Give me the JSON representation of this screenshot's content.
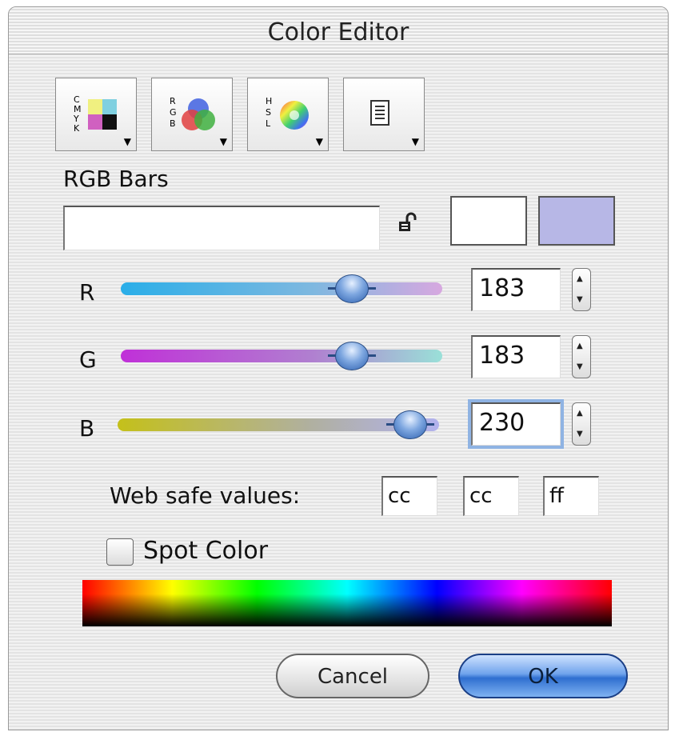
{
  "window": {
    "title": "Color Editor"
  },
  "pickers": [
    {
      "name": "cmyk-picker",
      "label": "CMYK"
    },
    {
      "name": "rgb-picker",
      "label": "RGB"
    },
    {
      "name": "hsl-picker",
      "label": "HSL"
    },
    {
      "name": "list-picker",
      "label": ""
    }
  ],
  "section_title": "RGB Bars",
  "color_name_field": {
    "value": ""
  },
  "swatches": {
    "original": "#ffffff",
    "new": "#b7b7e6"
  },
  "channels": [
    {
      "label": "R",
      "value": "183",
      "level": 0.72
    },
    {
      "label": "G",
      "value": "183",
      "level": 0.72
    },
    {
      "label": "B",
      "value": "230",
      "level": 0.9
    }
  ],
  "web_safe": {
    "label": "Web safe values:",
    "values": [
      "cc",
      "cc",
      "ff"
    ]
  },
  "spot_color": {
    "label": "Spot Color",
    "checked": false
  },
  "buttons": {
    "cancel": "Cancel",
    "ok": "OK"
  },
  "icons": [
    "lock-icon",
    "cmyk-icon",
    "rgb-icon",
    "hsl-icon",
    "list-icon",
    "dropdown-arrow-icon",
    "stepper-icon"
  ]
}
